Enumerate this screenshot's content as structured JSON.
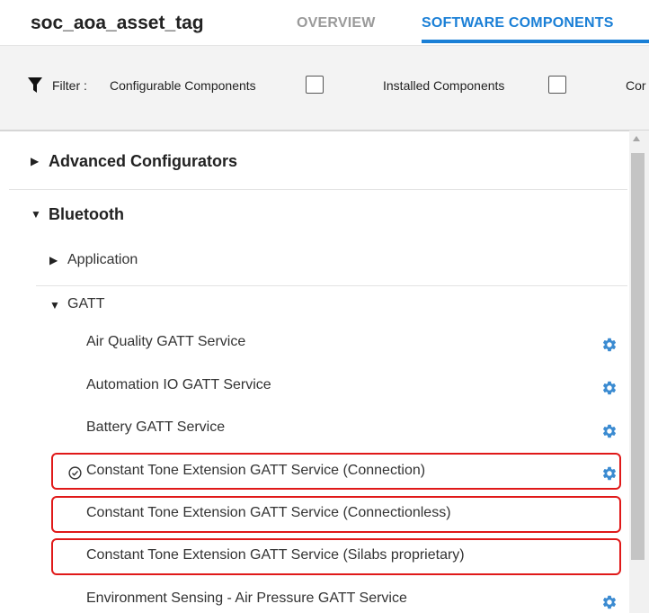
{
  "header": {
    "project_title": "soc_aoa_asset_tag",
    "tabs": [
      {
        "label": "OVERVIEW"
      },
      {
        "label": "SOFTWARE COMPONENTS"
      }
    ]
  },
  "filter": {
    "label": "Filter :",
    "options": [
      {
        "label": "Configurable Components",
        "checked": false
      },
      {
        "label": "Installed Components",
        "checked": false
      },
      {
        "label": "Cor"
      }
    ]
  },
  "tree": {
    "advanced_configurators": "Advanced Configurators",
    "bluetooth": "Bluetooth",
    "application": "Application",
    "gatt": "GATT",
    "items": [
      {
        "label": "Air Quality GATT Service"
      },
      {
        "label": "Automation IO GATT Service"
      },
      {
        "label": "Battery GATT Service"
      },
      {
        "label": "Constant Tone Extension GATT Service (Connection)"
      },
      {
        "label": "Constant Tone Extension GATT Service (Connectionless)"
      },
      {
        "label": "Constant Tone Extension GATT Service (Silabs proprietary)"
      },
      {
        "label": "Environment Sensing - Air Pressure GATT Service"
      }
    ]
  },
  "colors": {
    "accent": "#1a7fd6",
    "gear": "#3b8bd1",
    "highlight": "#e01919"
  }
}
